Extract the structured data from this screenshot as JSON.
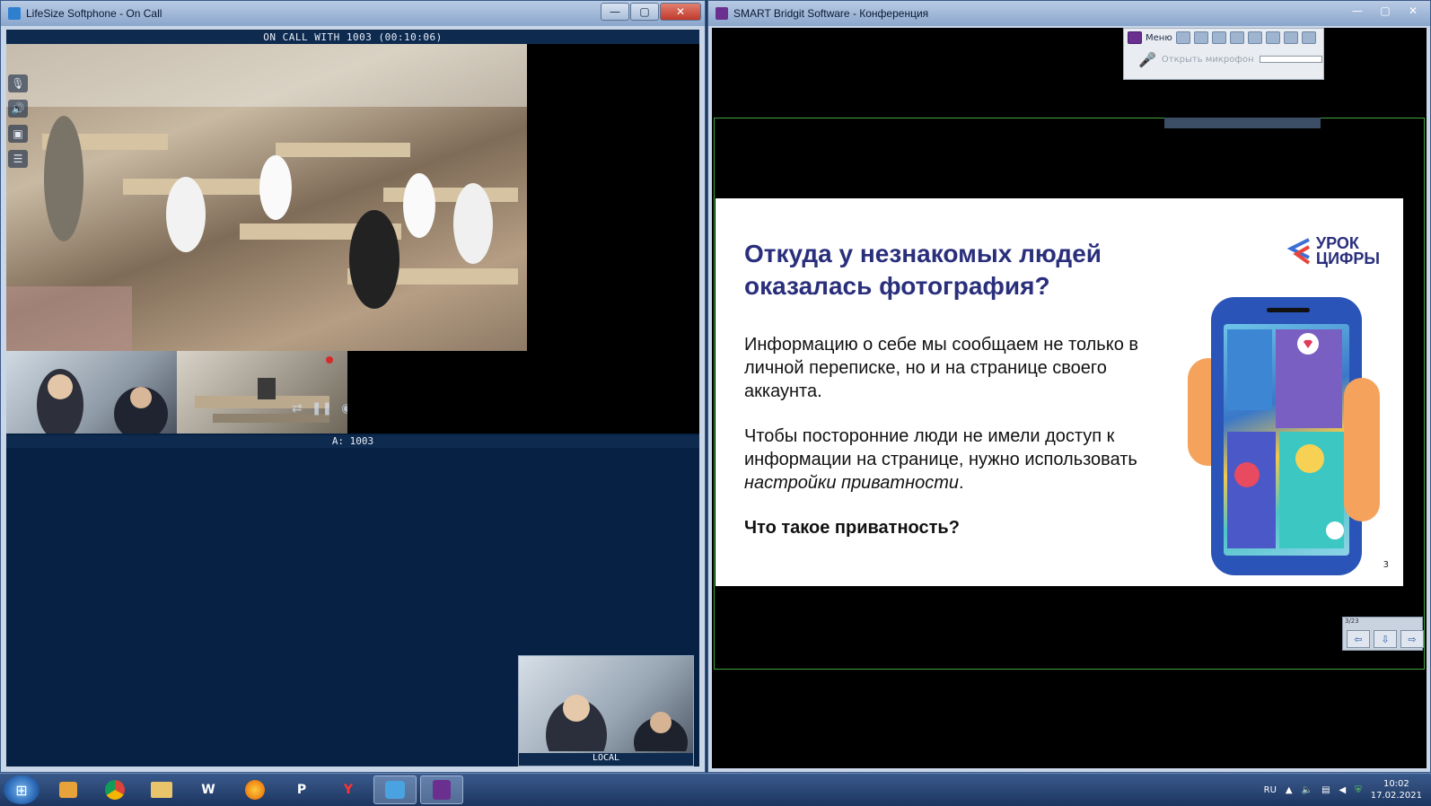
{
  "left_window": {
    "title": "LifeSize Softphone - On Call",
    "status_text": "ON CALL WITH 1003 (00:10:06)",
    "remote_label": "A: 1003",
    "local_label": "LOCAL",
    "side_controls": [
      "mic-mute",
      "speaker",
      "camera",
      "layout"
    ]
  },
  "right_window": {
    "title": "SMART Bridgit Software - Конференция",
    "toolbar": {
      "menu_label": "Меню",
      "mic_label": "Открыть микрофон"
    },
    "slide": {
      "title": "Откуда у незнакомых людей оказалась фотография?",
      "paragraph1": "Информацию о себе мы сообщаем не только в личной переписке, но и на странице своего аккаунта.",
      "paragraph2_lead": "Чтобы посторонние люди не имели доступ к информации на странице, нужно использовать ",
      "paragraph2_em": "настройки приватности",
      "paragraph2_tail": ".",
      "question": "Что такое приватность?",
      "logo_line1": "УРОК",
      "logo_line2": "ЦИФРЫ",
      "page_number": "3"
    },
    "nav": {
      "counter": "3/23"
    }
  },
  "window_buttons": {
    "minimize": "—",
    "maximize": "▢",
    "close": "✕"
  },
  "taskbar": {
    "apps": [
      "media-player",
      "chrome",
      "explorer",
      "word",
      "firefox",
      "powerpoint",
      "yandex",
      "lifesize",
      "bridgit"
    ],
    "word_label": "W",
    "powerpoint_label": "P",
    "yandex_label": "Y",
    "language": "RU",
    "time": "10:02",
    "date": "17.02.2021"
  }
}
